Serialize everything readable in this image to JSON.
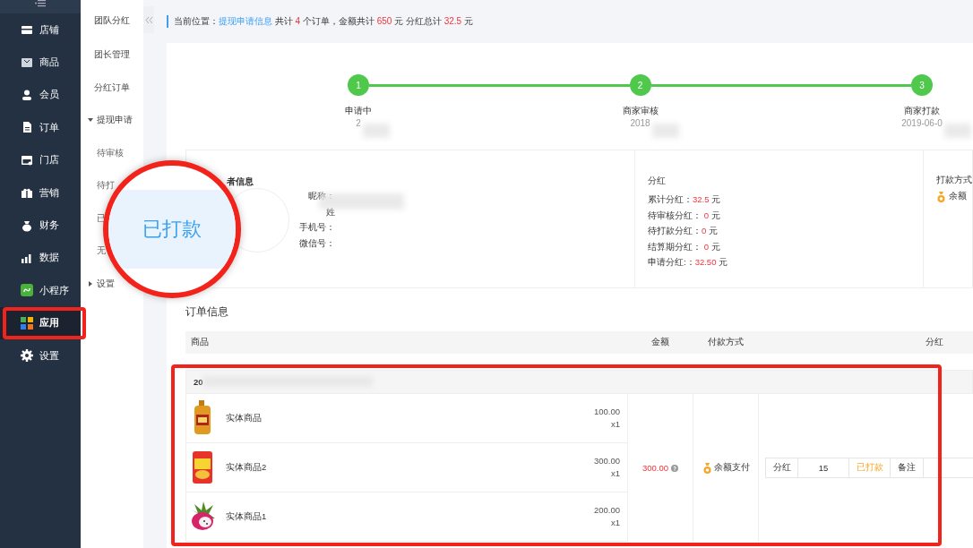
{
  "sidebar": {
    "items": [
      {
        "label": "店铺",
        "selected": false,
        "highlighted": false
      },
      {
        "label": "商品",
        "selected": false,
        "highlighted": false
      },
      {
        "label": "会员",
        "selected": false,
        "highlighted": false
      },
      {
        "label": "订单",
        "selected": false,
        "highlighted": false
      },
      {
        "label": "门店",
        "selected": false,
        "highlighted": false
      },
      {
        "label": "营销",
        "selected": false,
        "highlighted": false
      },
      {
        "label": "财务",
        "selected": false,
        "highlighted": false
      },
      {
        "label": "数据",
        "selected": false,
        "highlighted": false
      },
      {
        "label": "小程序",
        "selected": false,
        "highlighted": false
      },
      {
        "label": "应用",
        "selected": true,
        "highlighted": true
      },
      {
        "label": "设置",
        "selected": false,
        "highlighted": false
      }
    ]
  },
  "subnav": {
    "title": "团队分红",
    "items": [
      {
        "label": "团长管理",
        "kind": "item"
      },
      {
        "label": "分红订单",
        "kind": "item"
      },
      {
        "label": "提现申请",
        "kind": "group",
        "expanded": true
      },
      {
        "label": "待审核",
        "kind": "sub"
      },
      {
        "label": "待打",
        "kind": "sub"
      },
      {
        "label": "已",
        "kind": "sub"
      },
      {
        "label": "无",
        "kind": "sub"
      },
      {
        "label": "设置",
        "kind": "group",
        "expanded": false
      }
    ]
  },
  "breadcrumb": [
    {
      "text": "当前位置：",
      "kind": "plain"
    },
    {
      "text": "提现申请信息",
      "kind": "link"
    },
    {
      "text": " 共计 ",
      "kind": "plain"
    },
    {
      "text": "4",
      "kind": "highlight"
    },
    {
      "text": " 个订单，金额共计 ",
      "kind": "plain"
    },
    {
      "text": "650",
      "kind": "highlight"
    },
    {
      "text": " 元 分红总计 ",
      "kind": "plain"
    },
    {
      "text": "32.5",
      "kind": "highlight"
    },
    {
      "text": " 元",
      "kind": "plain"
    }
  ],
  "steps": [
    {
      "number": "1",
      "label": "申请中",
      "date": "2"
    },
    {
      "number": "2",
      "label": "商家审核",
      "date": "2018"
    },
    {
      "number": "3",
      "label": "商家打款",
      "date": "2019-06-0"
    }
  ],
  "buyer_info": {
    "title": "者信息",
    "fields": [
      {
        "label": "昵称："
      },
      {
        "label": "姓"
      },
      {
        "label": "手机号："
      },
      {
        "label": "微信号："
      }
    ]
  },
  "dividend": {
    "title": "分红",
    "rows": [
      {
        "label": "累计分红：",
        "value": "32.5",
        "unit": " 元"
      },
      {
        "label": "待审核分红： ",
        "value": "0",
        "unit": " 元"
      },
      {
        "label": "待打款分红：",
        "value": "0",
        "unit": " 元"
      },
      {
        "label": "结算期分红： ",
        "value": "0",
        "unit": " 元"
      },
      {
        "label": "申请分红:：",
        "value": "32.50",
        "unit": " 元"
      }
    ]
  },
  "payment": {
    "title": "打款方式",
    "method": "余额"
  },
  "orders": {
    "title": "订单信息",
    "columns": [
      "商品",
      "金额",
      "付款方式",
      "分红"
    ],
    "group": {
      "order_no": "20",
      "highlighted": true,
      "items": [
        {
          "name": "实体商品",
          "price": "100.00",
          "qty": "x1"
        },
        {
          "name": "实体商品2",
          "price": "300.00",
          "qty": "x1"
        },
        {
          "name": "实体商品1",
          "price": "200.00",
          "qty": "x1"
        }
      ],
      "amount": "300.00",
      "pay_method": "余额支付",
      "dividend": {
        "label": "分红",
        "value": "15",
        "status": "已打款",
        "note": "备注"
      }
    }
  },
  "magnifier": {
    "text": "已打款"
  }
}
